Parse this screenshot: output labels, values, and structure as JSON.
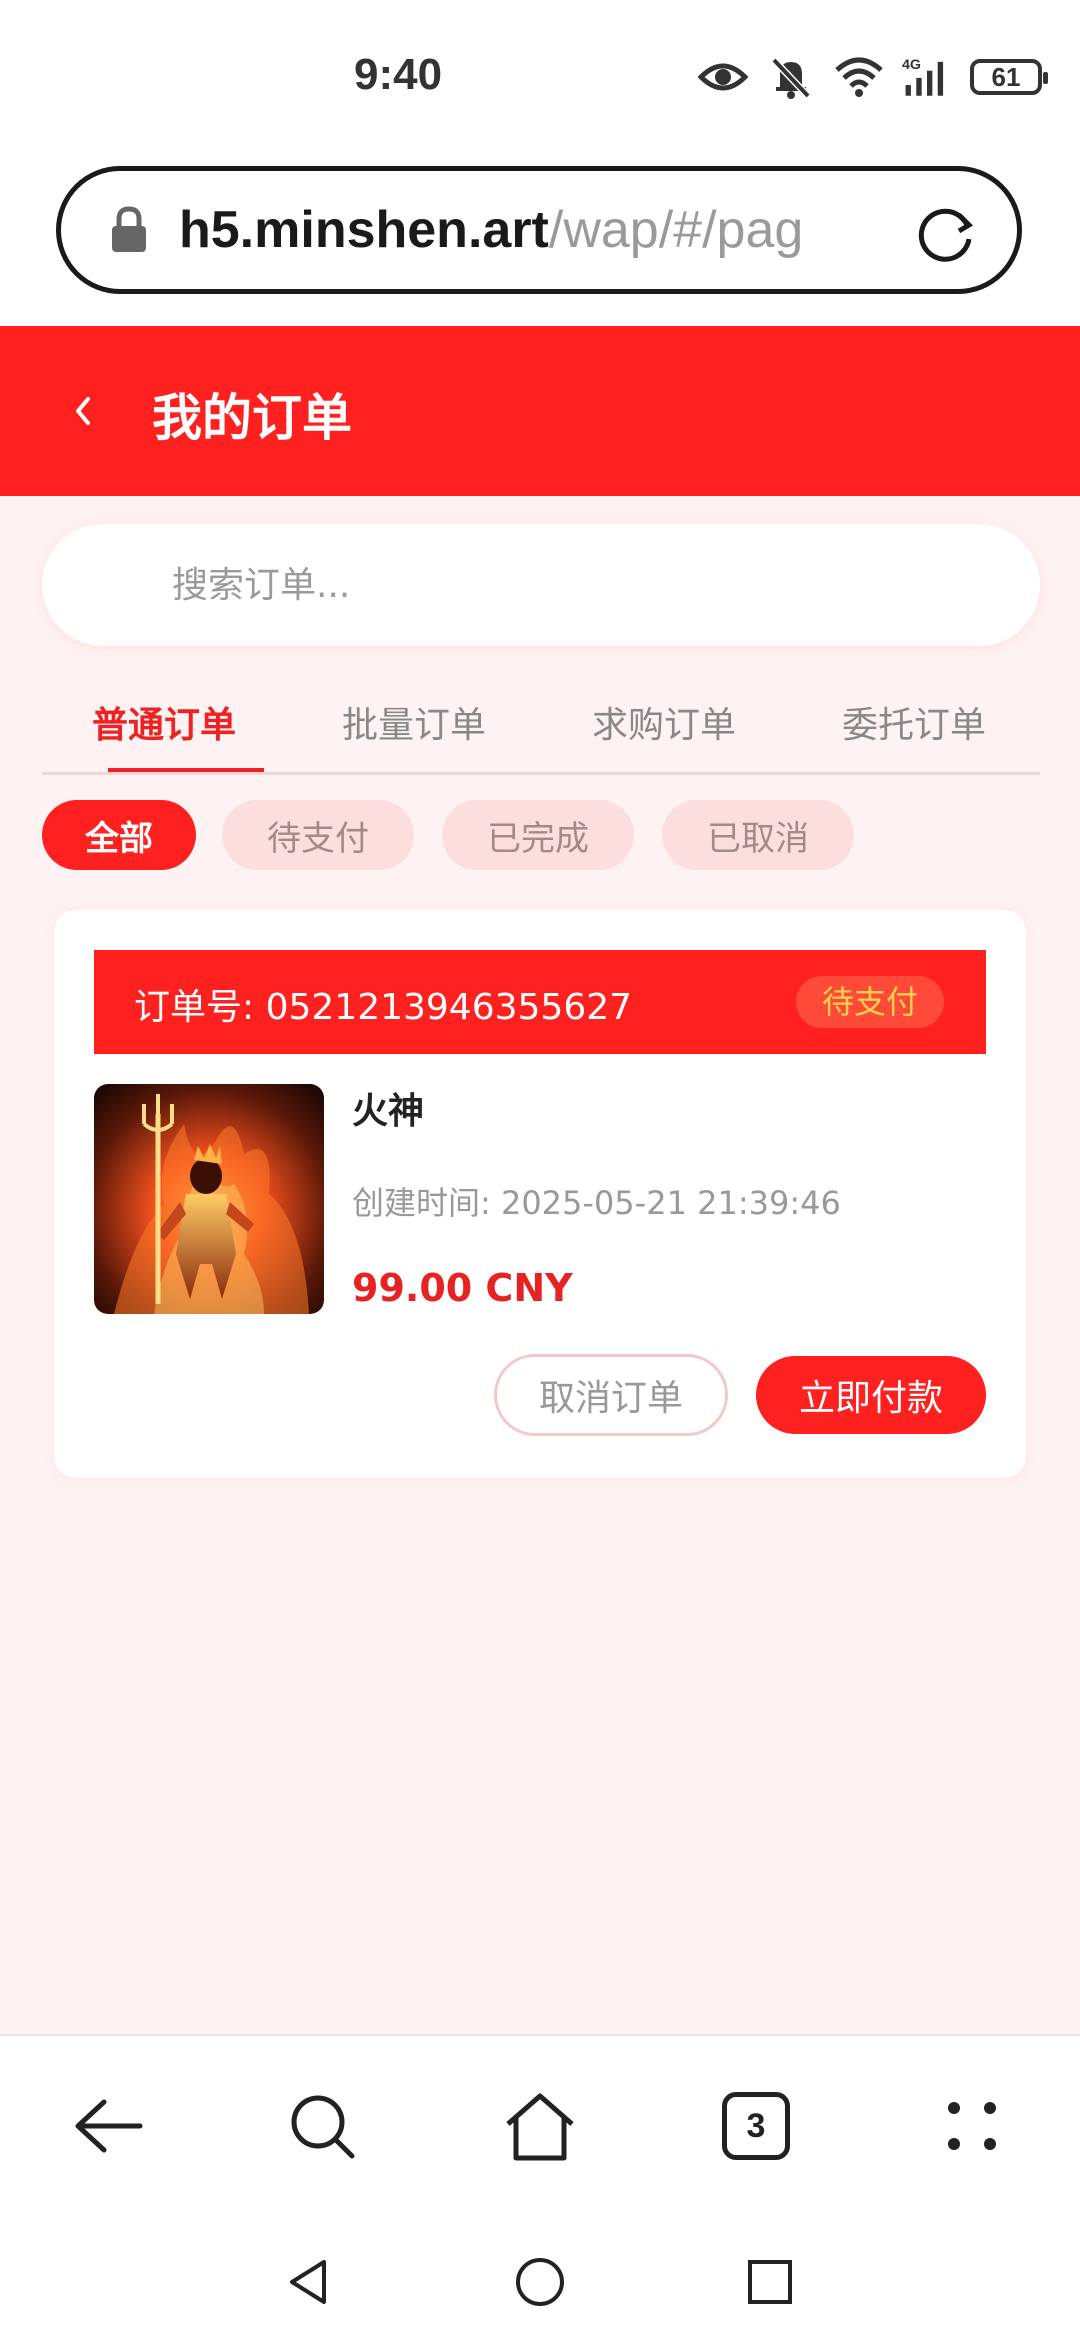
{
  "status_bar": {
    "time": "9:40",
    "battery": "61",
    "icons": [
      "eye-icon",
      "bell-off-icon",
      "wifi-icon",
      "signal-4g-icon",
      "battery-icon"
    ]
  },
  "browser": {
    "url_host": "h5.minshen.art",
    "url_path": "/wap/#/pag"
  },
  "header": {
    "title": "我的订单"
  },
  "search": {
    "placeholder": "搜索订单..."
  },
  "tabs": [
    {
      "label": "普通订单",
      "active": true
    },
    {
      "label": "批量订单",
      "active": false
    },
    {
      "label": "求购订单",
      "active": false
    },
    {
      "label": "委托订单",
      "active": false
    }
  ],
  "filters": [
    {
      "label": "全部",
      "active": true
    },
    {
      "label": "待支付",
      "active": false
    },
    {
      "label": "已完成",
      "active": false
    },
    {
      "label": "已取消",
      "active": false
    }
  ],
  "order": {
    "number_label": "订单号: 0521213946355627",
    "status": "待支付",
    "product_name": "火神",
    "created_time": "创建时间: 2025-05-21 21:39:46",
    "price": "99.00 CNY",
    "cancel_label": "取消订单",
    "pay_label": "立即付款"
  },
  "bottom_nav": {
    "tab_count": "3"
  },
  "colors": {
    "accent": "#ff2020",
    "page_bg": "#fff2f2",
    "status_text": "#ffd24a"
  }
}
